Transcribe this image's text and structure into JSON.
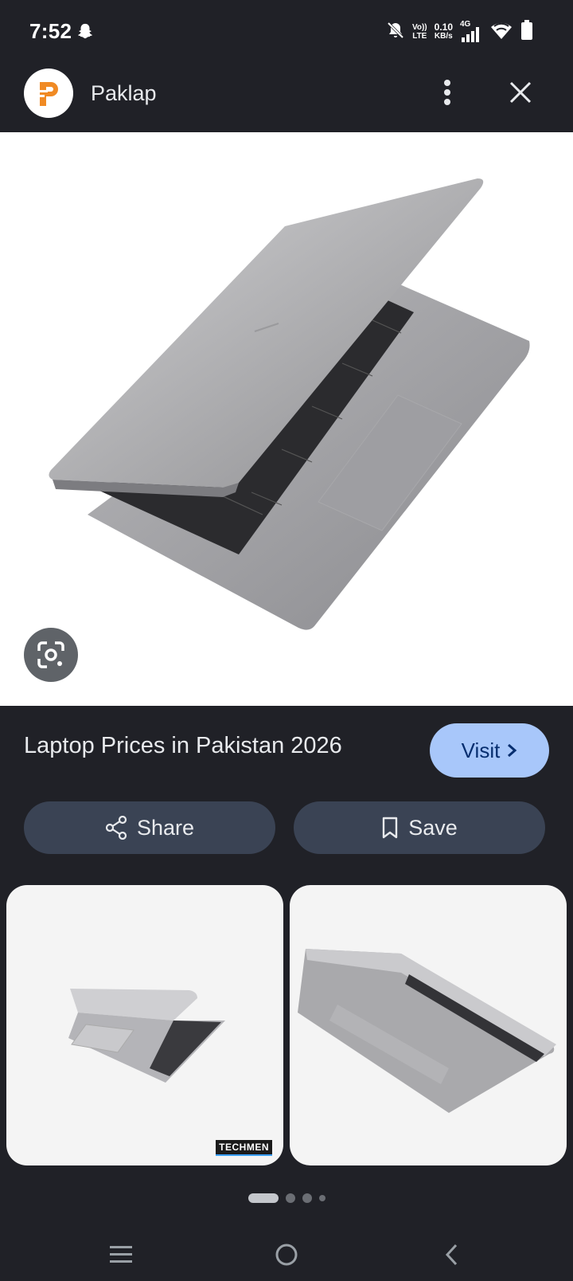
{
  "status": {
    "time": "7:52",
    "volte": [
      "Vo))",
      "LTE"
    ],
    "speed": [
      "0.10",
      "KB/s"
    ],
    "network": "4G"
  },
  "header": {
    "site_name": "Paklap"
  },
  "result": {
    "title": "Laptop Prices in Pakistan 2026",
    "visit_label": "Visit"
  },
  "actions": {
    "share_label": "Share",
    "save_label": "Save"
  },
  "related": {
    "watermark": "TECHMEN"
  },
  "colors": {
    "background": "#202127",
    "visit_button": "#a8c7fa",
    "action_button": "#3a4354"
  }
}
